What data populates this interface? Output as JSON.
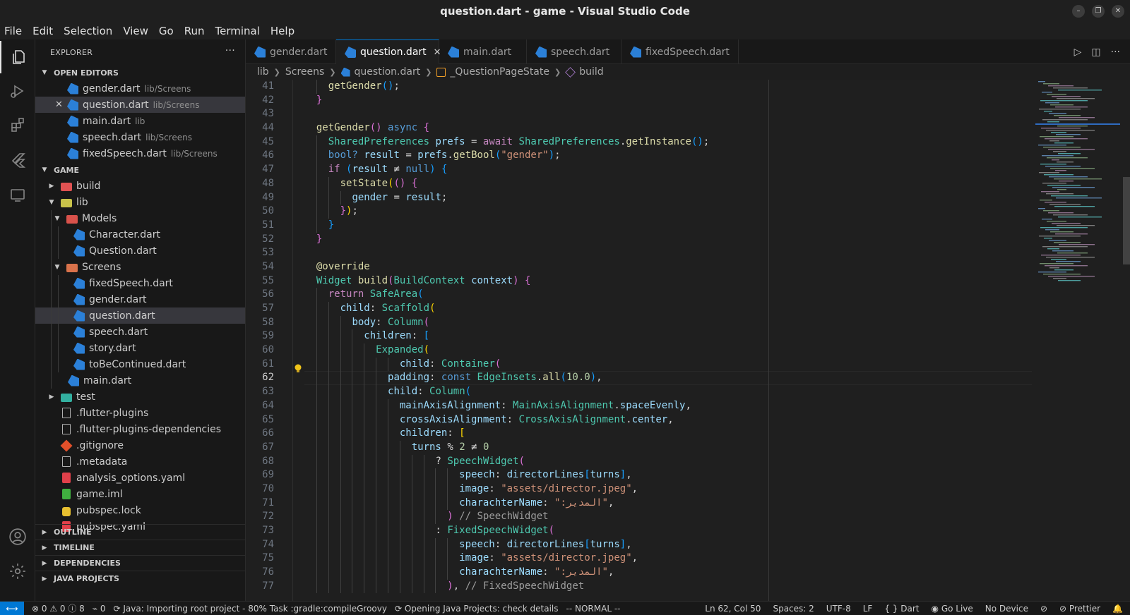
{
  "window": {
    "title": "question.dart - game - Visual Studio Code"
  },
  "menu": [
    "File",
    "Edit",
    "Selection",
    "View",
    "Go",
    "Run",
    "Terminal",
    "Help"
  ],
  "explorer": {
    "title": "EXPLORER",
    "open_editors_title": "OPEN EDITORS",
    "open_editors": [
      {
        "name": "gender.dart",
        "path": "lib/Screens"
      },
      {
        "name": "question.dart",
        "path": "lib/Screens"
      },
      {
        "name": "main.dart",
        "path": "lib"
      },
      {
        "name": "speech.dart",
        "path": "lib/Screens"
      },
      {
        "name": "fixedSpeech.dart",
        "path": "lib/Screens"
      }
    ],
    "project_title": "GAME",
    "tree": [
      {
        "name": "build"
      },
      {
        "name": "lib"
      },
      {
        "name": "Models"
      },
      {
        "name": "Character.dart"
      },
      {
        "name": "Question.dart"
      },
      {
        "name": "Screens"
      },
      {
        "name": "fixedSpeech.dart"
      },
      {
        "name": "gender.dart"
      },
      {
        "name": "question.dart"
      },
      {
        "name": "speech.dart"
      },
      {
        "name": "story.dart"
      },
      {
        "name": "toBeContinued.dart"
      },
      {
        "name": "main.dart"
      },
      {
        "name": "test"
      },
      {
        "name": ".flutter-plugins"
      },
      {
        "name": ".flutter-plugins-dependencies"
      },
      {
        "name": ".gitignore"
      },
      {
        "name": ".metadata"
      },
      {
        "name": "analysis_options.yaml"
      },
      {
        "name": "game.iml"
      },
      {
        "name": "pubspec.lock"
      },
      {
        "name": "pubspec.yaml"
      }
    ],
    "bottom_sections": [
      "OUTLINE",
      "TIMELINE",
      "DEPENDENCIES",
      "JAVA PROJECTS"
    ]
  },
  "tabs": [
    {
      "label": "gender.dart"
    },
    {
      "label": "question.dart"
    },
    {
      "label": "main.dart"
    },
    {
      "label": "speech.dart"
    },
    {
      "label": "fixedSpeech.dart"
    }
  ],
  "breadcrumb": [
    "lib",
    "Screens",
    "question.dart",
    "_QuestionPageState",
    "build"
  ],
  "code": {
    "current_line": 62,
    "lines": [
      {
        "n": 41,
        "text": "    getGender();"
      },
      {
        "n": 42,
        "text": "  }"
      },
      {
        "n": 43,
        "text": ""
      },
      {
        "n": 44,
        "text": "  getGender() async {"
      },
      {
        "n": 45,
        "text": "    SharedPreferences prefs = await SharedPreferences.getInstance();"
      },
      {
        "n": 46,
        "text": "    bool? result = prefs.getBool(\"gender\");"
      },
      {
        "n": 47,
        "text": "    if (result ≠ null) {"
      },
      {
        "n": 48,
        "text": "      setState(() {"
      },
      {
        "n": 49,
        "text": "        gender = result;"
      },
      {
        "n": 50,
        "text": "      });"
      },
      {
        "n": 51,
        "text": "    }"
      },
      {
        "n": 52,
        "text": "  }"
      },
      {
        "n": 53,
        "text": ""
      },
      {
        "n": 54,
        "text": "  @override"
      },
      {
        "n": 55,
        "text": "  Widget build(BuildContext context) {"
      },
      {
        "n": 56,
        "text": "    return SafeArea("
      },
      {
        "n": 57,
        "text": "      child: Scaffold("
      },
      {
        "n": 58,
        "text": "        body: Column("
      },
      {
        "n": 59,
        "text": "          children: ["
      },
      {
        "n": 60,
        "text": "            Expanded("
      },
      {
        "n": 61,
        "text": "                child: Container("
      },
      {
        "n": 62,
        "text": "              padding: const EdgeInsets.all(10.0),"
      },
      {
        "n": 63,
        "text": "              child: Column("
      },
      {
        "n": 64,
        "text": "                mainAxisAlignment: MainAxisAlignment.spaceEvenly,"
      },
      {
        "n": 65,
        "text": "                crossAxisAlignment: CrossAxisAlignment.center,"
      },
      {
        "n": 66,
        "text": "                children: ["
      },
      {
        "n": 67,
        "text": "                  turns % 2 ≠ 0"
      },
      {
        "n": 68,
        "text": "                      ? SpeechWidget("
      },
      {
        "n": 69,
        "text": "                          speech: directorLines[turns],"
      },
      {
        "n": 70,
        "text": "                          image: \"assets/director.jpeg\","
      },
      {
        "n": 71,
        "text": "                          charachterName: \":المدير\","
      },
      {
        "n": 72,
        "text": "                        ) // SpeechWidget"
      },
      {
        "n": 73,
        "text": "                      : FixedSpeechWidget("
      },
      {
        "n": 74,
        "text": "                          speech: directorLines[turns],"
      },
      {
        "n": 75,
        "text": "                          image: \"assets/director.jpeg\","
      },
      {
        "n": 76,
        "text": "                          charachterName: \":المدير\","
      },
      {
        "n": 77,
        "text": "                        ), // FixedSpeechWidget"
      }
    ]
  },
  "statusbar": {
    "problems": "⊗ 0 ⚠ 0 ⓘ 8",
    "ports": "0",
    "java_task": "Java: Importing root project - 80% Task :gradle:compileGroovy",
    "java_projects": "Opening Java Projects: check details",
    "vim_mode": "-- NORMAL --",
    "cursor": "Ln 62, Col 50",
    "spaces": "Spaces: 2",
    "encoding": "UTF-8",
    "eol": "LF",
    "language": "Dart",
    "golive": "Go Live",
    "device": "No Device",
    "prettier": "Prettier"
  },
  "colors": {
    "accent": "#0078d4",
    "selection": "#37373d",
    "background": "#1e1e1e"
  }
}
